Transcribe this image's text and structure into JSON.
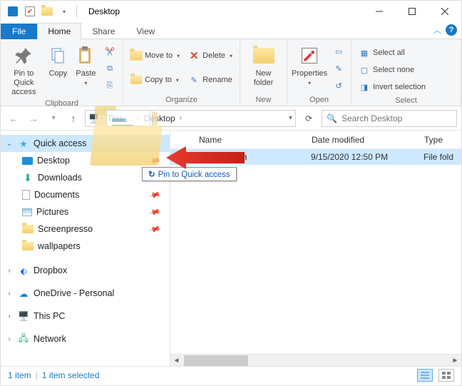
{
  "window": {
    "title": "Desktop"
  },
  "tabs": {
    "file": "File",
    "home": "Home",
    "share": "Share",
    "view": "View"
  },
  "ribbon": {
    "clipboard": {
      "label": "Clipboard",
      "pin": "Pin to Quick\naccess",
      "copy": "Copy",
      "paste": "Paste"
    },
    "organize": {
      "label": "Organize",
      "moveto": "Move to",
      "copyto": "Copy to",
      "delete": "Delete",
      "rename": "Rename"
    },
    "new": {
      "label": "New",
      "newfolder": "New\nfolder"
    },
    "open": {
      "label": "Open",
      "properties": "Properties"
    },
    "select": {
      "label": "Select",
      "selectall": "Select all",
      "selectnone": "Select none",
      "invert": "Invert selection"
    }
  },
  "addressbar": {
    "crumb1": "This ...",
    "crumb2": "Desktop"
  },
  "search": {
    "placeholder": "Search Desktop"
  },
  "navpane": {
    "quick": "Quick access",
    "desktop": "Desktop",
    "downloads": "Downloads",
    "documents": "Documents",
    "pictures": "Pictures",
    "screenpresso": "Screenpresso",
    "wallpapers": "wallpapers",
    "dropbox": "Dropbox",
    "onedrive": "OneDrive - Personal",
    "thispc": "This PC",
    "network": "Network"
  },
  "columns": {
    "name": "Name",
    "date": "Date modified",
    "type": "Type"
  },
  "rows": [
    {
      "name": "Digital Citizen",
      "date": "9/15/2020 12:50 PM",
      "type": "File fold"
    }
  ],
  "dragtip": "Pin to Quick access",
  "status": {
    "count": "1 item",
    "selected": "1 item selected"
  }
}
